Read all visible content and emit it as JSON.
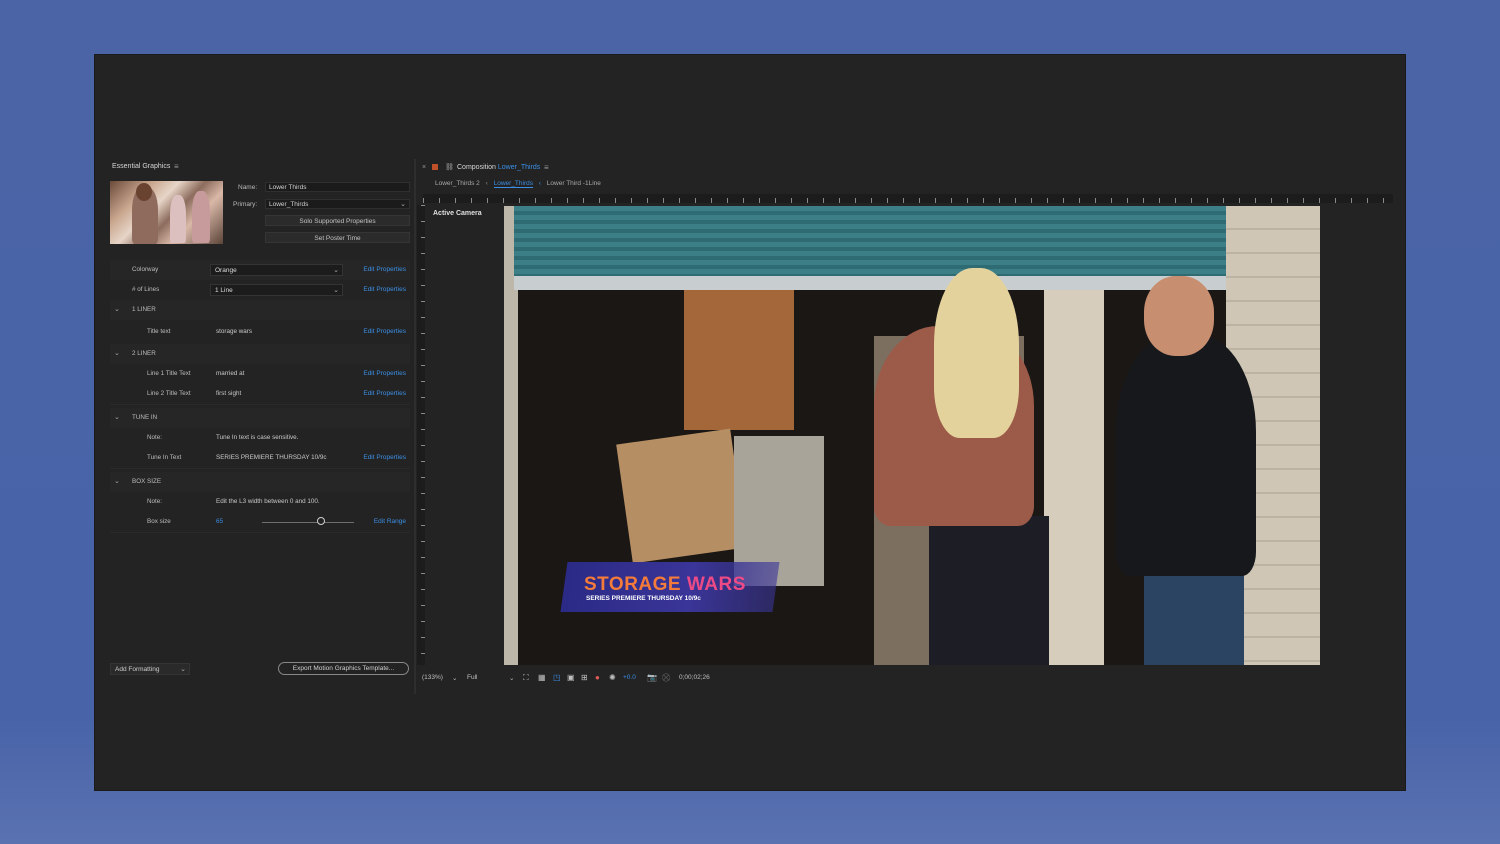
{
  "essential_graphics": {
    "title": "Essential Graphics",
    "name_label": "Name:",
    "name_value": "Lower Thirds",
    "primary_label": "Primary:",
    "primary_value": "Lower_Thirds",
    "solo_button": "Solo Supported Properties",
    "poster_button": "Set Poster Time",
    "rows": [
      {
        "name": "Colorway",
        "value": "Orange",
        "edit": "Edit Properties",
        "type": "dropdown"
      },
      {
        "name": "# of Lines",
        "value": "1 Line",
        "edit": "Edit Properties",
        "type": "dropdown"
      },
      {
        "name": "1 LINER",
        "type": "group"
      },
      {
        "name": "Title text",
        "value": "storage wars",
        "edit": "Edit Properties",
        "type": "text"
      },
      {
        "name": "2 LINER",
        "type": "group"
      },
      {
        "name": "Line 1 Title Text",
        "value": "married at",
        "edit": "Edit Properties",
        "type": "text"
      },
      {
        "name": "Line 2 Title Text",
        "value": "first sight",
        "edit": "Edit Properties",
        "type": "text"
      },
      {
        "name": "TUNE IN",
        "type": "group"
      },
      {
        "name": "Note:",
        "value": "Tune In text is case sensitive.",
        "type": "note"
      },
      {
        "name": "Tune In Text",
        "value": "SERIES PREMIERE THURSDAY 10/9c",
        "edit": "Edit Properties",
        "type": "text"
      },
      {
        "name": "BOX SIZE",
        "type": "group"
      },
      {
        "name": "Note:",
        "value": "Edit the L3 width between 0 and 100.",
        "type": "note"
      },
      {
        "name": "Box size",
        "value": "65",
        "edit": "Edit Range",
        "type": "slider"
      }
    ],
    "add_formatting": "Add Formatting",
    "export_button": "Export Motion Graphics Template..."
  },
  "composition": {
    "close_glyph": "×",
    "title_prefix": "Composition",
    "title_name": "Lower_Thirds",
    "tabs": [
      "Lower_Thirds 2",
      "Lower_Thirds",
      "Lower Third -1Line"
    ],
    "active_camera": "Active Camera",
    "lower_third": {
      "title_word1": "STORAGE",
      "title_word2": "WARS",
      "subtitle": "SERIES PREMIERE THURSDAY 10/9c"
    },
    "status": {
      "zoom": "(133%)",
      "resolution": "Full",
      "exposure": "+0.0",
      "timecode": "0;00;02;26"
    }
  },
  "colors": {
    "accent_blue": "#3b8fe6",
    "title_orange": "#f47b3a",
    "title_pink": "#ee4a86"
  }
}
